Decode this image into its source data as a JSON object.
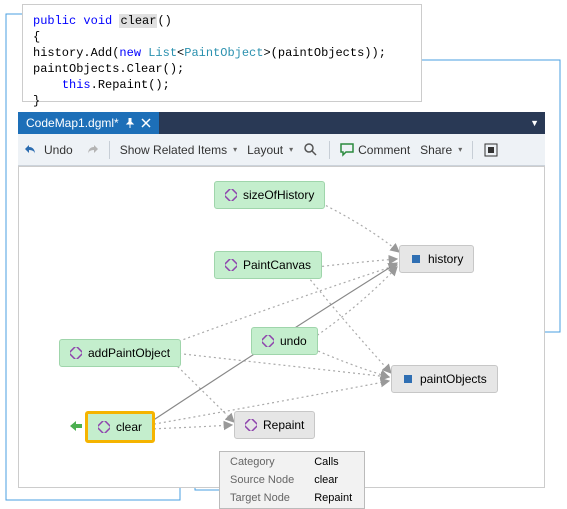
{
  "code": {
    "l1a": "public",
    "l1b": "void",
    "l1c": "clear",
    "l1d": "()",
    "l2": "{",
    "l3a": "    history.Add(",
    "l3b": "new",
    "l3c": "List",
    "l3d": "PaintObject",
    "l3e": ">(paintObjects));",
    "l4": "    paintObjects.Clear();",
    "l5a": "this",
    "l5b": ".Repaint();",
    "l6": "}"
  },
  "tab": {
    "title": "CodeMap1.dgml*",
    "pin": "⇪",
    "close": "✕",
    "arrow": "▼"
  },
  "toolbar": {
    "undo": "Undo",
    "related": "Show Related Items",
    "layout": "Layout",
    "comment": "Comment",
    "share": "Share"
  },
  "nodes": {
    "sizeOfHistory": "sizeOfHistory",
    "history": "history",
    "paintCanvas": "PaintCanvas",
    "undo": "undo",
    "paintObjects": "paintObjects",
    "addPaintObject": "addPaintObject",
    "clear": "clear",
    "repaint": "Repaint"
  },
  "tooltip": {
    "k1": "Category",
    "v1": "Calls",
    "k2": "Source Node",
    "v2": "clear",
    "k3": "Target Node",
    "v3": "Repaint"
  }
}
